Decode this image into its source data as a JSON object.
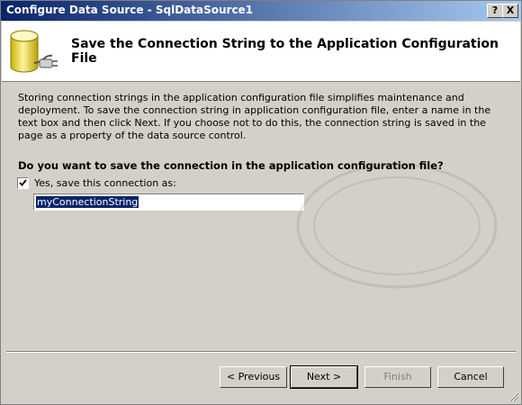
{
  "window": {
    "title": "Configure Data Source - SqlDataSource1",
    "help_glyph": "?",
    "close_glyph": "X"
  },
  "header": {
    "title": "Save the Connection String to the Application Configuration File",
    "icon": "database-plug-icon"
  },
  "body": {
    "description": "Storing connection strings in the application configuration file simplifies maintenance and deployment. To save the connection string in application configuration file, enter a name in the text box and then click Next. If you choose not to do this, the connection string is saved in the page as a property of the data source control.",
    "question": "Do you want to save the connection in the application configuration file?",
    "save_checkbox": {
      "label": "Yes, save this connection as:",
      "checked": true
    },
    "connection_name": {
      "value": "myConnectionString"
    }
  },
  "buttons": {
    "previous": "< Previous",
    "next": "Next >",
    "finish": "Finish",
    "cancel": "Cancel"
  },
  "colors": {
    "titlebar_start": "#0a246a",
    "titlebar_end": "#a6caf0",
    "dialog_face": "#d4d0c8",
    "selection": "#0a246a"
  }
}
